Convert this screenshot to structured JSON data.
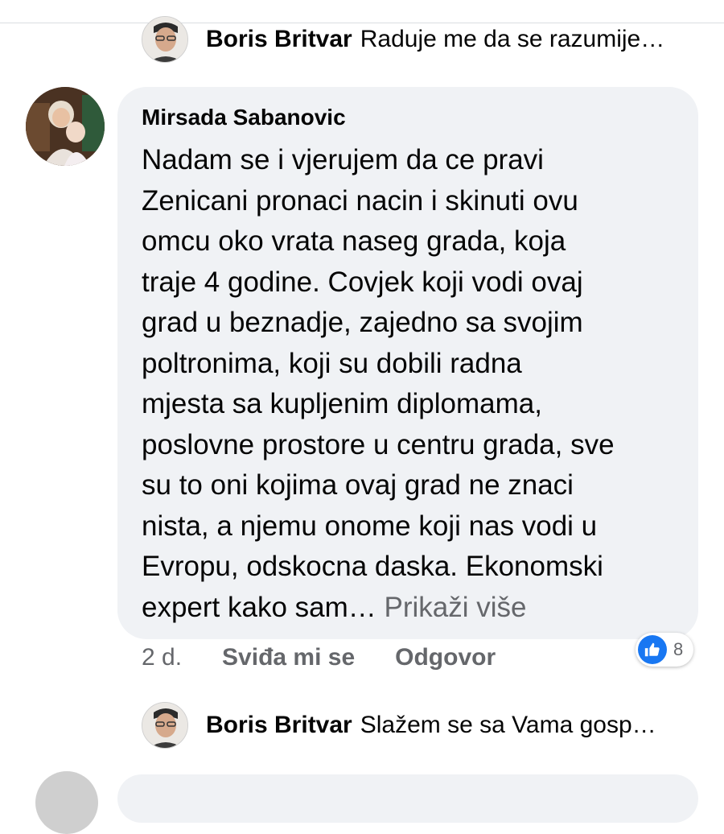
{
  "reply_preview_top": {
    "author": "Boris Britvar",
    "snippet": "Raduje me da se razumije…"
  },
  "comment": {
    "author": "Mirsada Sabanovic",
    "text": "Nadam se i vjerujem da ce pravi\nZenicani pronaci nacin i skinuti ovu\nomcu oko vrata naseg grada, koja\ntraje 4 godine. Covjek koji vodi ovaj\ngrad u beznadje, zajedno sa svojim\npoltronima, koji su dobili radna\nmjesta sa kupljenim diplomama,\nposlovne prostore u centru grada, sve\nsu to oni kojima ovaj grad ne znaci\nnista, a njemu onome koji nas vodi u\nEvropu, odskocna daska. Ekonomski\nexpert kako sam… ",
    "see_more": "Prikaži više",
    "time": "2 d.",
    "like_label": "Sviđa mi se",
    "reply_label": "Odgovor",
    "reaction_count": "8",
    "reaction_icon": "thumbs-up-icon",
    "accent_color": "#1877f2"
  },
  "reply_preview_bottom": {
    "author": "Boris Britvar",
    "snippet": "Slažem se sa Vama gosp…"
  }
}
